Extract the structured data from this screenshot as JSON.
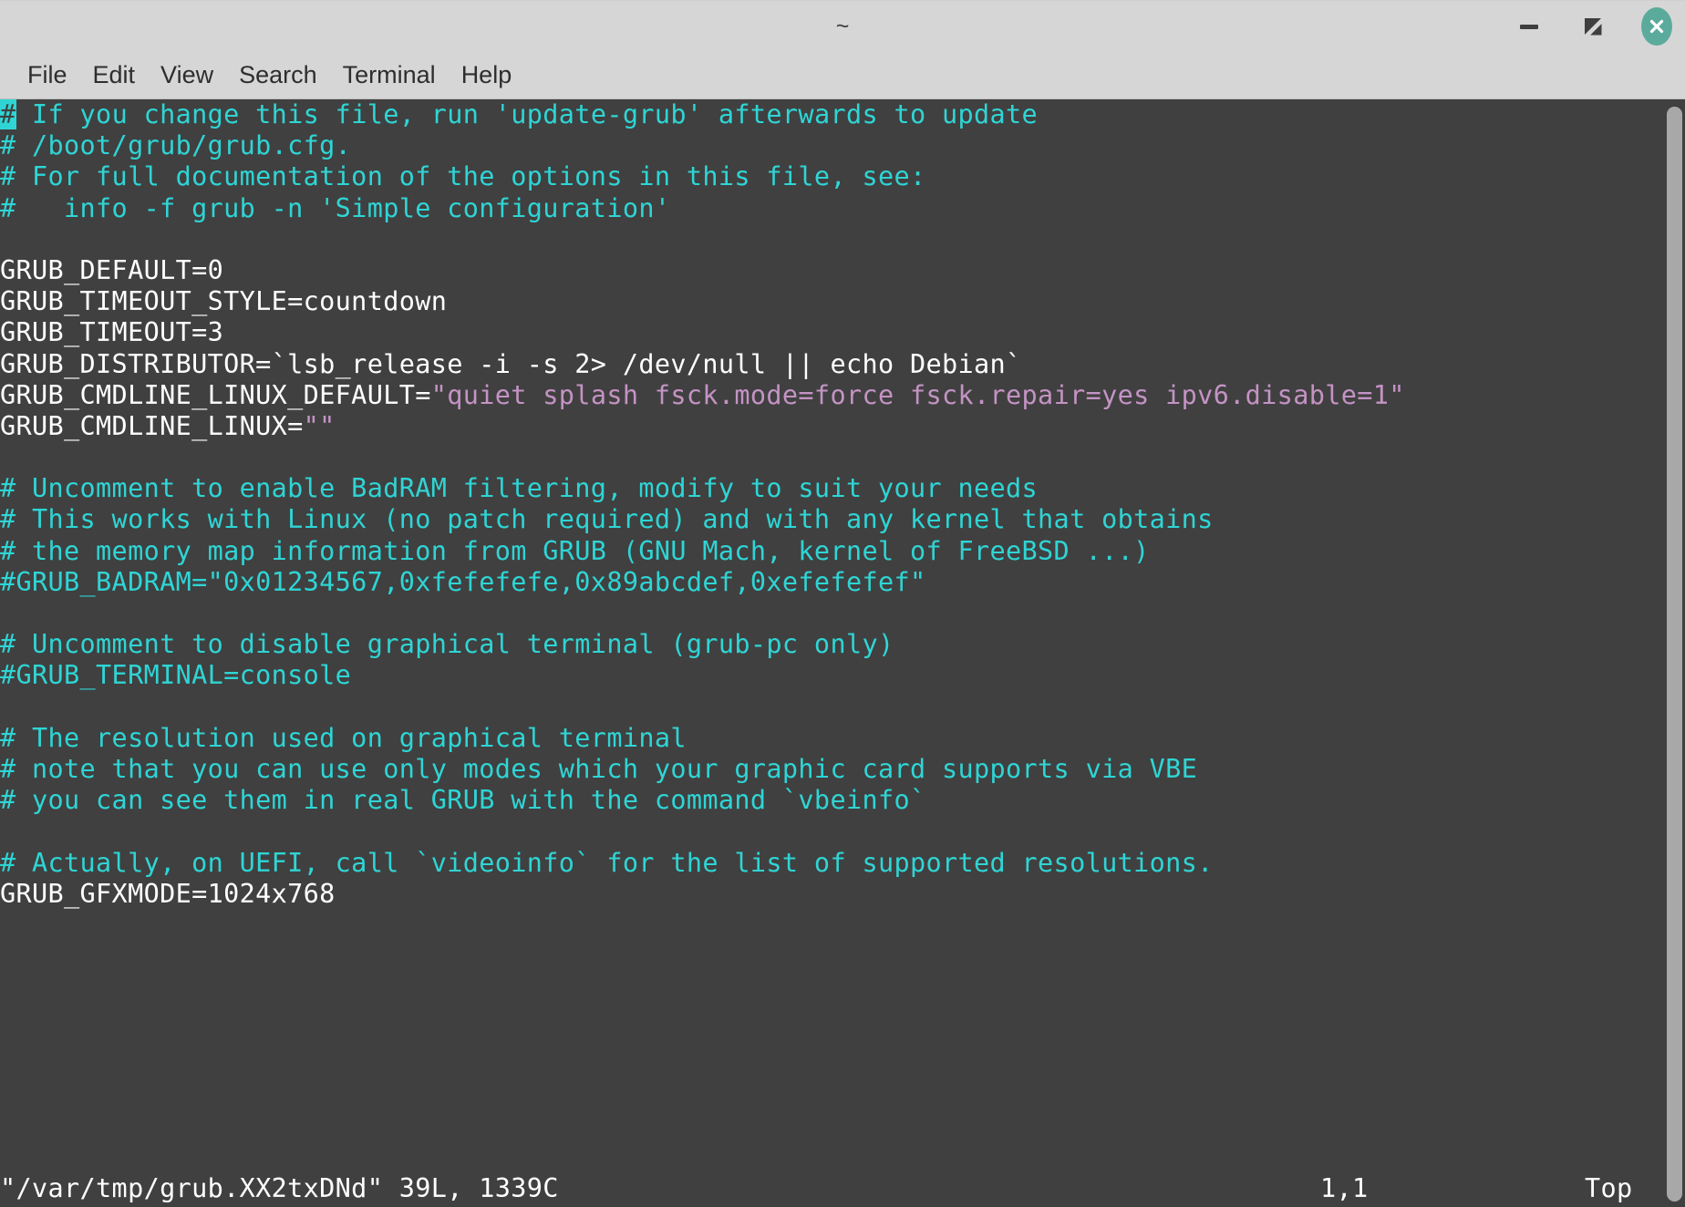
{
  "window": {
    "title": "~",
    "controls": [
      {
        "name": "minimize-button",
        "label": "minimize"
      },
      {
        "name": "maximize-button",
        "label": "maximize"
      },
      {
        "name": "close-button",
        "label": "close"
      }
    ],
    "close_button_color": "#5bab9c"
  },
  "menubar": {
    "items": [
      {
        "label": "File"
      },
      {
        "label": "Edit"
      },
      {
        "label": "View"
      },
      {
        "label": "Search"
      },
      {
        "label": "Terminal"
      },
      {
        "label": "Help"
      }
    ]
  },
  "terminal": {
    "background_color": "#404040",
    "comment_color": "#2fd5d5",
    "plain_color": "#ffffff",
    "string_color": "#c493c4",
    "cursor": {
      "line": 1,
      "column": 1,
      "char": "#"
    },
    "lines": [
      "# If you change this file, run 'update-grub' afterwards to update",
      "# /boot/grub/grub.cfg.",
      "# For full documentation of the options in this file, see:",
      "#   info -f grub -n 'Simple configuration'",
      "",
      "GRUB_DEFAULT=0",
      "GRUB_TIMEOUT_STYLE=countdown",
      "GRUB_TIMEOUT=3",
      "GRUB_DISTRIBUTOR=`lsb_release -i -s 2> /dev/null || echo Debian`",
      "GRUB_CMDLINE_LINUX_DEFAULT=\"quiet splash fsck.mode=force fsck.repair=yes ipv6.disable=1\"",
      "GRUB_CMDLINE_LINUX=\"\"",
      "",
      "# Uncomment to enable BadRAM filtering, modify to suit your needs",
      "# This works with Linux (no patch required) and with any kernel that obtains",
      "# the memory map information from GRUB (GNU Mach, kernel of FreeBSD ...)",
      "#GRUB_BADRAM=\"0x01234567,0xfefefefe,0x89abcdef,0xefefefef\"",
      "",
      "# Uncomment to disable graphical terminal (grub-pc only)",
      "#GRUB_TERMINAL=console",
      "",
      "# The resolution used on graphical terminal",
      "# note that you can use only modes which your graphic card supports via VBE",
      "# you can see them in real GRUB with the command `vbeinfo`",
      "",
      "# Actually, on UEFI, call `videoinfo` for the list of supported resolutions.",
      "GRUB_GFXMODE=1024x768"
    ],
    "segments": [
      [
        {
          "t": "# If you change this file, run 'update-grub' afterwards to update",
          "c": "comment",
          "cursor_first": true
        }
      ],
      [
        {
          "t": "# /boot/grub/grub.cfg.",
          "c": "comment"
        }
      ],
      [
        {
          "t": "# For full documentation of the options in this file, see:",
          "c": "comment"
        }
      ],
      [
        {
          "t": "#   info -f grub -n 'Simple configuration'",
          "c": "comment"
        }
      ],
      [
        {
          "t": "",
          "c": "plain"
        }
      ],
      [
        {
          "t": "GRUB_DEFAULT=0",
          "c": "plain"
        }
      ],
      [
        {
          "t": "GRUB_TIMEOUT_STYLE=countdown",
          "c": "plain"
        }
      ],
      [
        {
          "t": "GRUB_TIMEOUT=3",
          "c": "plain"
        }
      ],
      [
        {
          "t": "GRUB_DISTRIBUTOR=`lsb_release -i -s 2> /dev/null || echo Debian`",
          "c": "plain"
        }
      ],
      [
        {
          "t": "GRUB_CMDLINE_LINUX_DEFAULT=",
          "c": "plain"
        },
        {
          "t": "\"quiet splash fsck.mode=force fsck.repair=yes ipv6.disable=1\"",
          "c": "string"
        }
      ],
      [
        {
          "t": "GRUB_CMDLINE_LINUX=",
          "c": "plain"
        },
        {
          "t": "\"\"",
          "c": "string"
        }
      ],
      [
        {
          "t": "",
          "c": "plain"
        }
      ],
      [
        {
          "t": "# Uncomment to enable BadRAM filtering, modify to suit your needs",
          "c": "comment"
        }
      ],
      [
        {
          "t": "# This works with Linux (no patch required) and with any kernel that obtains",
          "c": "comment"
        }
      ],
      [
        {
          "t": "# the memory map information from GRUB (GNU Mach, kernel of FreeBSD ...)",
          "c": "comment"
        }
      ],
      [
        {
          "t": "#GRUB_BADRAM=\"0x01234567,0xfefefefe,0x89abcdef,0xefefefef\"",
          "c": "comment"
        }
      ],
      [
        {
          "t": "",
          "c": "plain"
        }
      ],
      [
        {
          "t": "# Uncomment to disable graphical terminal (grub-pc only)",
          "c": "comment"
        }
      ],
      [
        {
          "t": "#GRUB_TERMINAL=console",
          "c": "comment"
        }
      ],
      [
        {
          "t": "",
          "c": "plain"
        }
      ],
      [
        {
          "t": "# The resolution used on graphical terminal",
          "c": "comment"
        }
      ],
      [
        {
          "t": "# note that you can use only modes which your graphic card supports via VBE",
          "c": "comment"
        }
      ],
      [
        {
          "t": "# you can see them in real GRUB with the command `vbeinfo`",
          "c": "comment"
        }
      ],
      [
        {
          "t": "",
          "c": "plain"
        }
      ],
      [
        {
          "t": "# Actually, on UEFI, call `videoinfo` for the list of supported resolutions.",
          "c": "comment"
        }
      ],
      [
        {
          "t": "GRUB_GFXMODE=1024x768",
          "c": "plain"
        }
      ]
    ]
  },
  "statusline": {
    "file": "\"/var/tmp/grub.XX2txDNd\" 39L, 1339C",
    "position": "1,1",
    "location": "Top"
  },
  "scrollbar": {
    "name": "vertical-scrollbar",
    "thumb_color": "#a8a8a8"
  }
}
